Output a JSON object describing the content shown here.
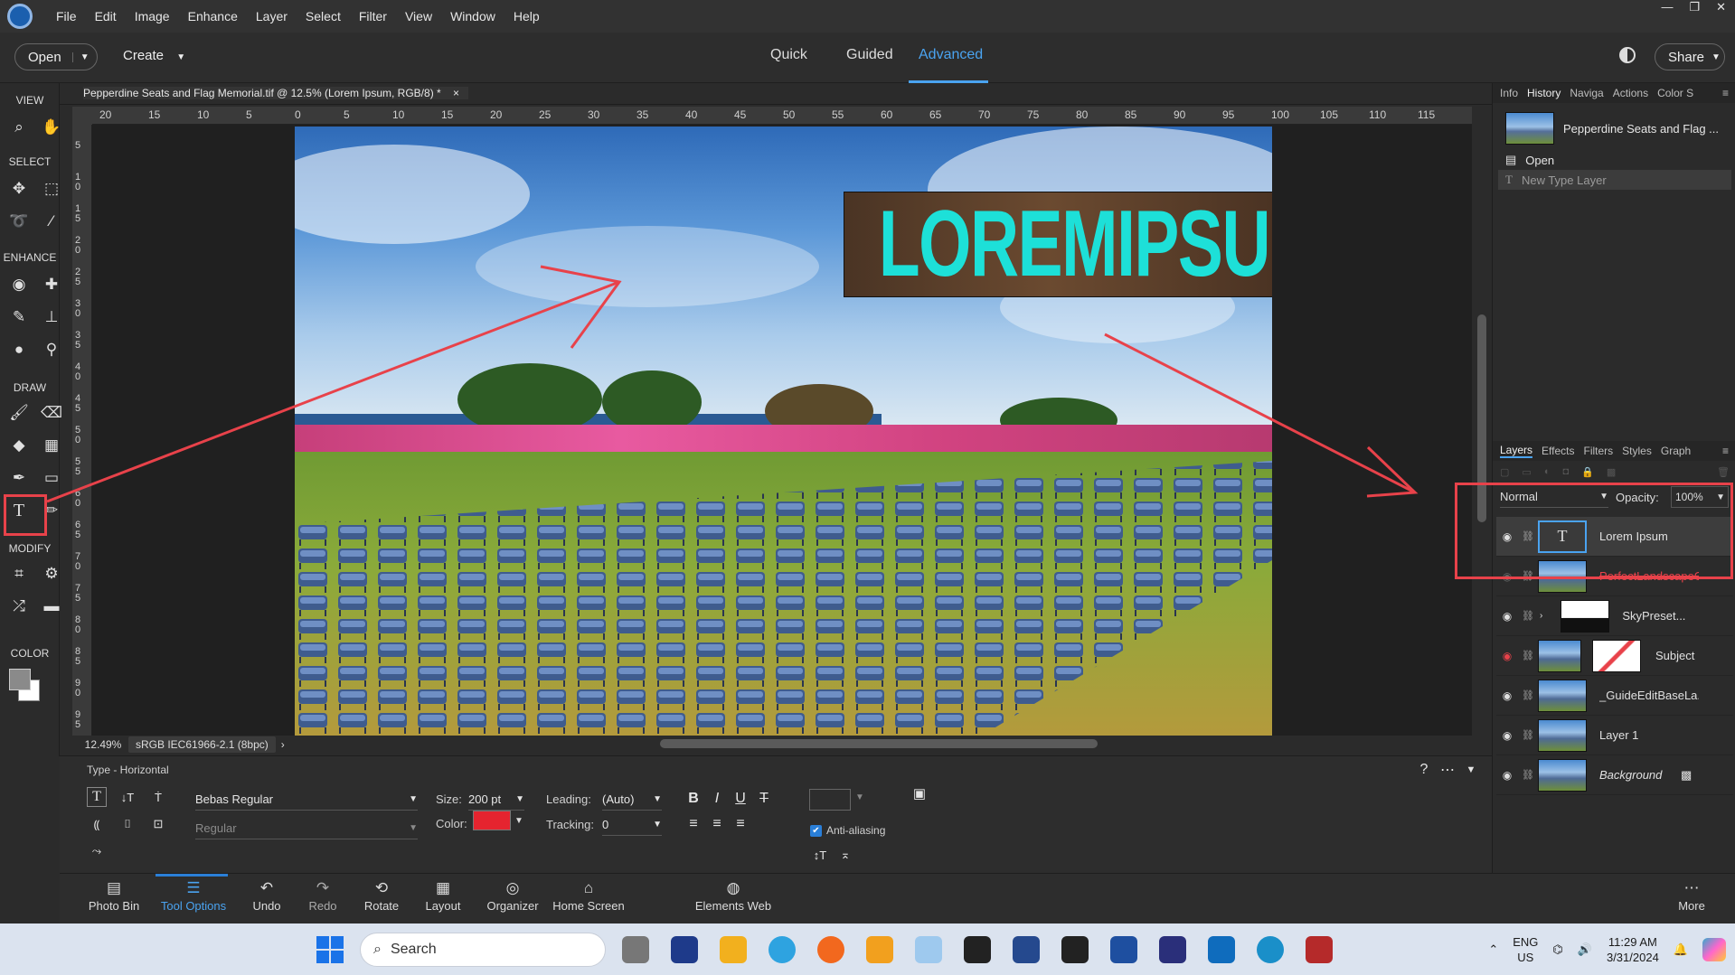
{
  "menu": [
    "File",
    "Edit",
    "Image",
    "Enhance",
    "Layer",
    "Select",
    "Filter",
    "View",
    "Window",
    "Help"
  ],
  "window_controls": [
    "—",
    "❐",
    "✕"
  ],
  "modebar": {
    "open_label": "Open",
    "create_label": "Create",
    "tabs": [
      "Quick",
      "Guided",
      "Advanced"
    ],
    "active_tab": "Advanced",
    "share_label": "Share"
  },
  "toolbox": {
    "sections": [
      "VIEW",
      "SELECT",
      "ENHANCE",
      "DRAW",
      "MODIFY",
      "COLOR"
    ],
    "active_tool": "type-tool"
  },
  "document": {
    "tab_title": "Pepperdine Seats and Flag Memorial.tif @ 12.5% (Lorem Ipsum, RGB/8) *",
    "zoom_text": "12.49%",
    "profile_text": "sRGB IEC61966-2.1 (8bpc)"
  },
  "ruler_top": [
    "20",
    "15",
    "10",
    "5",
    "0",
    "5",
    "10",
    "15",
    "20",
    "25",
    "30",
    "35",
    "40",
    "45",
    "50",
    "55",
    "60",
    "65",
    "70",
    "75",
    "80",
    "85",
    "90",
    "95",
    "100",
    "105",
    "110",
    "115"
  ],
  "ruler_left": [
    "5",
    "1\n0",
    "1\n5",
    "2\n0",
    "2\n5",
    "3\n0",
    "3\n5",
    "4\n0",
    "4\n5",
    "5\n0",
    "5\n5",
    "6\n0",
    "6\n5",
    "7\n0",
    "7\n5",
    "8\n0",
    "8\n5",
    "9\n0",
    "9\n5"
  ],
  "canvas": {
    "text_layer_content": "LOREMIPSUM",
    "text_color": "#1de0d8"
  },
  "tool_options": {
    "title": "Type - Horizontal",
    "font_family": "Bebas Regular",
    "font_style": "Regular",
    "size_label": "Size:",
    "size_value": "200 pt",
    "leading_label": "Leading:",
    "leading_value": "(Auto)",
    "color_label": "Color:",
    "color_value": "#e5242f",
    "tracking_label": "Tracking:",
    "tracking_value": "0",
    "anti_aliasing_label": "Anti-aliasing",
    "anti_aliasing_checked": true
  },
  "bottom_bar": [
    {
      "label": "Photo Bin",
      "icon": "photo-bin-icon"
    },
    {
      "label": "Tool Options",
      "icon": "tool-options-icon"
    },
    {
      "label": "Undo",
      "icon": "undo-icon"
    },
    {
      "label": "Redo",
      "icon": "redo-icon"
    },
    {
      "label": "Rotate",
      "icon": "rotate-icon"
    },
    {
      "label": "Layout",
      "icon": "layout-icon"
    },
    {
      "label": "Organizer",
      "icon": "organizer-icon"
    },
    {
      "label": "Home Screen",
      "icon": "home-icon"
    },
    {
      "label": "Elements Web",
      "icon": "globe-icon"
    },
    {
      "label": "More",
      "icon": "more-icon"
    }
  ],
  "history_panel": {
    "tabs": [
      "Info",
      "History",
      "Naviga",
      "Actions",
      "Color S"
    ],
    "active_tab": "History",
    "snapshot_name": "Pepperdine Seats and Flag ...",
    "states": [
      "Open",
      "New Type Layer"
    ]
  },
  "layers_panel": {
    "tabs": [
      "Layers",
      "Effects",
      "Filters",
      "Styles",
      "Graph"
    ],
    "active_tab": "Layers",
    "blend_mode": "Normal",
    "opacity_label": "Opacity:",
    "opacity_value": "100%",
    "layers": [
      "Lorem Ipsum",
      "PerfectLandscapeG...",
      "SkyPreset...",
      "Subject",
      "_GuideEditBaseLa...",
      "Layer 1",
      "Background"
    ]
  },
  "taskbar": {
    "search_placeholder": "Search",
    "language_line1": "ENG",
    "language_line2": "US",
    "time": "11:29 AM",
    "date": "3/31/2024"
  }
}
